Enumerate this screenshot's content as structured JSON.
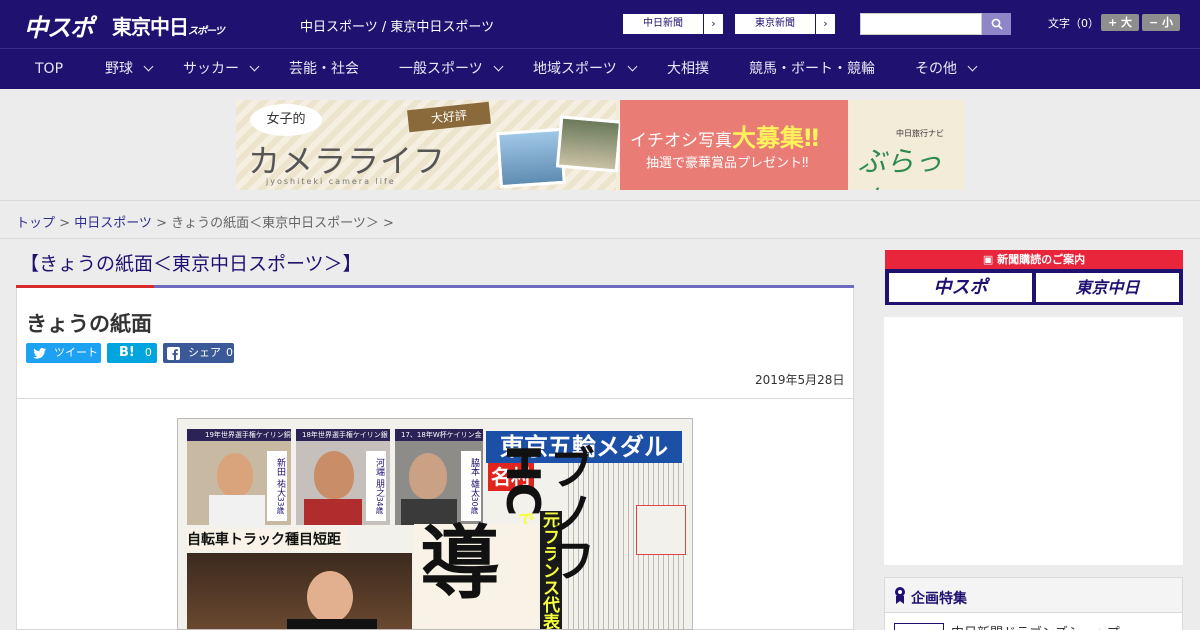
{
  "header": {
    "logo_chuspo": "中スポ",
    "logo_tokyo": "東京中日",
    "logo_tokyo_small": "スポーツ",
    "site_names": "中日スポーツ / 東京中日スポーツ",
    "paper_links": [
      {
        "label": "中日新聞"
      },
      {
        "label": "東京新聞"
      }
    ],
    "arrow": "›",
    "search": {
      "value": "",
      "placeholder": ""
    },
    "font_size_label": "文字（0）",
    "font_larger": "+ 大",
    "font_smaller": "− 小"
  },
  "nav": {
    "items": [
      {
        "label": "TOP"
      },
      {
        "label": "野球"
      },
      {
        "label": "サッカー"
      },
      {
        "label": "芸能・社会"
      },
      {
        "label": "一般スポーツ"
      },
      {
        "label": "地域スポーツ"
      },
      {
        "label": "大相撲"
      },
      {
        "label": "競馬・ボート・競輪"
      },
      {
        "label": "その他"
      }
    ]
  },
  "banner": {
    "bubble": "女子的",
    "title": "カメラライフ",
    "sub": "jyoshiteki camera life",
    "ribbon": "大好評",
    "main_prefix": "イチオシ写真",
    "main_big": "大募集‼",
    "sub_line": "抽選で豪華賞品プレゼント‼",
    "nav_small": "中日旅行ナビ",
    "logo": "ぶらっ人"
  },
  "breadcrumb": {
    "top": "トップ",
    "sep": " > ",
    "chunichi": "中日スポーツ",
    "current": "きょうの紙面＜東京中日スポーツ＞ >"
  },
  "article": {
    "section_title": "【きょうの紙面＜東京中日スポーツ＞】",
    "title": "きょうの紙面",
    "share": {
      "tweet": "ツイート",
      "hatena_count": "0",
      "fb_label": "シェア",
      "fb_count": "0"
    },
    "date": "2019年5月28日"
  },
  "paper": {
    "headline": "東京五輪メダル",
    "name_tag": "名村",
    "sub_headline": "自転車トラック種目短距離",
    "riders": [
      {
        "header": "19年世界選手権ケイリン銅",
        "name": "新田 祐大",
        "age": "33歳"
      },
      {
        "header": "18年世界選手権ケイリン銀",
        "name": "河端 朋之",
        "age": "34歳"
      },
      {
        "header": "17、18年W杯ケイリン金",
        "name": "脇本 雄太",
        "age": "30歳"
      }
    ],
    "vertical_text": "元フランス代表で",
    "big_char": "ブノワHC",
    "big_char2": "導"
  },
  "sidebar": {
    "subscribe_head": "新聞購読のご案内",
    "sub_chuspo": "中スポ",
    "sub_tokyo": "東京中日",
    "feature_title": "企画特集",
    "feature_item": "中日新聞ドラゴンズショップ"
  },
  "colors": {
    "brand": "#1f1170",
    "accent_red": "#d92b2b",
    "twitter": "#1da1f2",
    "hatena": "#00a4de",
    "facebook": "#3b5998"
  }
}
